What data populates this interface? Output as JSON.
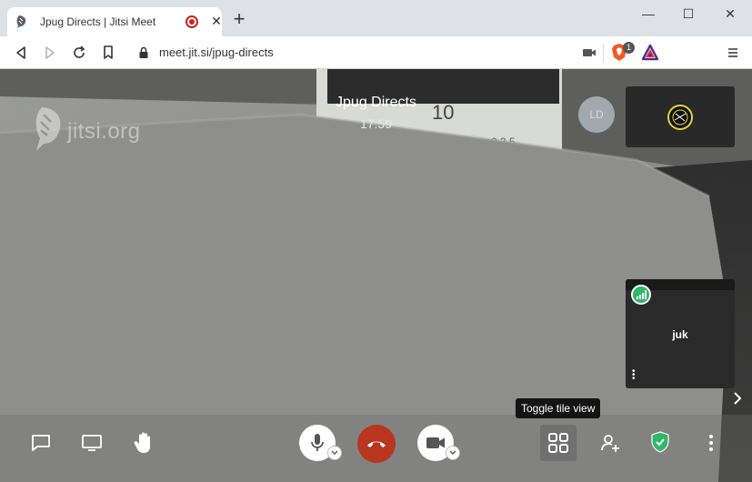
{
  "browser": {
    "tab_title": "Jpug Directs | Jitsi Meet",
    "url": "meet.jit.si/jpug-directs",
    "brave_badge_count": "1"
  },
  "meeting": {
    "watermark": "jitsi.org",
    "title": "Jpug Directs",
    "time": "17:59",
    "avatar_initials": "LD",
    "participant_name": "juk",
    "tooltip": "Toggle tile view"
  },
  "colors": {
    "hangup": "#b8351f",
    "signal": "#31b76a",
    "shield": "#31b76a"
  },
  "icons": {
    "chat": "chat-icon",
    "screenshare": "screenshare-icon",
    "raise_hand": "raise-hand-icon",
    "microphone": "microphone-icon",
    "hangup": "hangup-icon",
    "camera": "camera-icon",
    "tile_view": "tile-view-icon",
    "invite": "invite-icon",
    "security": "shield-icon",
    "more": "more-icon"
  }
}
